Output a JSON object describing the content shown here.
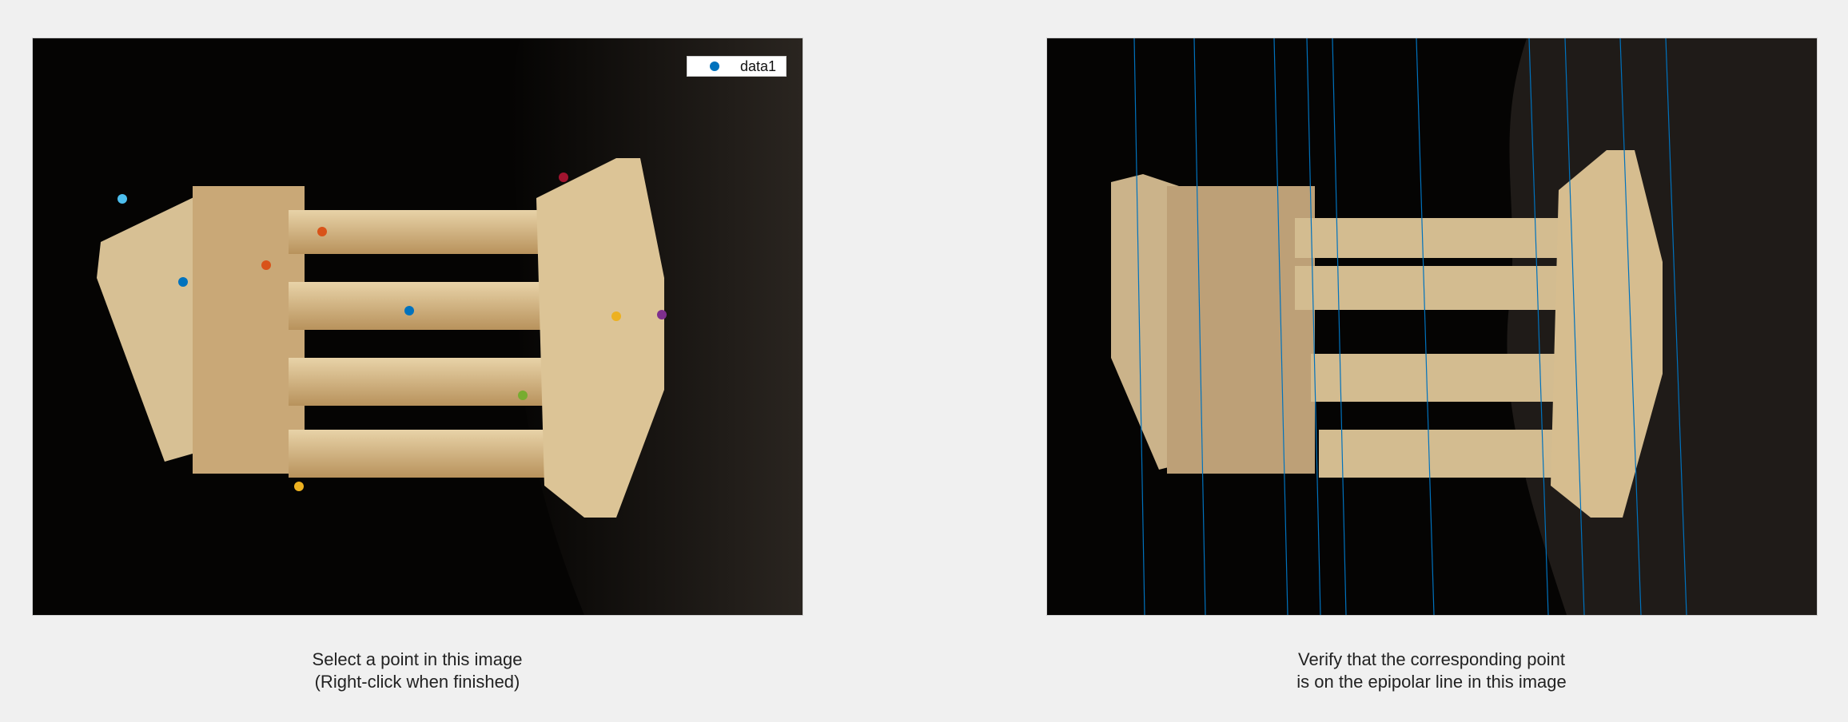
{
  "legend": {
    "label": "data1",
    "marker_color": "#0072BD"
  },
  "left_panel": {
    "caption_line1": "Select a point in this image",
    "caption_line2": "(Right-click when finished)"
  },
  "right_panel": {
    "caption_line1": "Verify that the corresponding point",
    "caption_line2": "is on the epipolar line in this image"
  },
  "selected_point_colors": [
    "#4DBEEE",
    "#0072BD",
    "#D95319",
    "#D95319",
    "#0072BD",
    "#A2142F",
    "#EDB120",
    "#7E2F8E",
    "#77AC30",
    "#EDB120"
  ],
  "epipolar_line_color": "#0072BD"
}
